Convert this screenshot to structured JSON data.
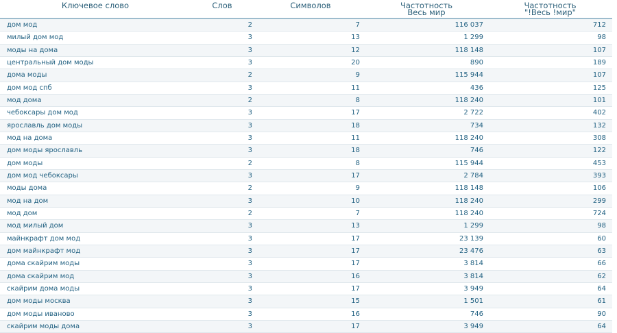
{
  "table": {
    "headers": {
      "keyword": "Ключевое слово",
      "words": "Слов",
      "chars": "Символов",
      "freq_line1": "Частотность",
      "freq_line2": "Весь мир",
      "freq_exact_line1": "Частотность",
      "freq_exact_line2": "\"!Весь !мир\""
    },
    "rows": [
      {
        "keyword": "дом мод",
        "words": "2",
        "chars": "7",
        "freq": "116 037",
        "freq_exact": "712"
      },
      {
        "keyword": "милый дом мод",
        "words": "3",
        "chars": "13",
        "freq": "1 299",
        "freq_exact": "98"
      },
      {
        "keyword": "моды на дома",
        "words": "3",
        "chars": "12",
        "freq": "118 148",
        "freq_exact": "107"
      },
      {
        "keyword": "центральный дом моды",
        "words": "3",
        "chars": "20",
        "freq": "890",
        "freq_exact": "189"
      },
      {
        "keyword": "дома моды",
        "words": "2",
        "chars": "9",
        "freq": "115 944",
        "freq_exact": "107"
      },
      {
        "keyword": "дом мод спб",
        "words": "3",
        "chars": "11",
        "freq": "436",
        "freq_exact": "125"
      },
      {
        "keyword": "мод дома",
        "words": "2",
        "chars": "8",
        "freq": "118 240",
        "freq_exact": "101"
      },
      {
        "keyword": "чебоксары дом мод",
        "words": "3",
        "chars": "17",
        "freq": "2 722",
        "freq_exact": "402"
      },
      {
        "keyword": "ярославль дом моды",
        "words": "3",
        "chars": "18",
        "freq": "734",
        "freq_exact": "132"
      },
      {
        "keyword": "мод на дома",
        "words": "3",
        "chars": "11",
        "freq": "118 240",
        "freq_exact": "308"
      },
      {
        "keyword": "дом моды ярославль",
        "words": "3",
        "chars": "18",
        "freq": "746",
        "freq_exact": "122"
      },
      {
        "keyword": "дом моды",
        "words": "2",
        "chars": "8",
        "freq": "115 944",
        "freq_exact": "453"
      },
      {
        "keyword": "дом мод чебоксары",
        "words": "3",
        "chars": "17",
        "freq": "2 784",
        "freq_exact": "393"
      },
      {
        "keyword": "моды дома",
        "words": "2",
        "chars": "9",
        "freq": "118 148",
        "freq_exact": "106"
      },
      {
        "keyword": "мод на дом",
        "words": "3",
        "chars": "10",
        "freq": "118 240",
        "freq_exact": "299"
      },
      {
        "keyword": "мод дом",
        "words": "2",
        "chars": "7",
        "freq": "118 240",
        "freq_exact": "724"
      },
      {
        "keyword": "мод милый дом",
        "words": "3",
        "chars": "13",
        "freq": "1 299",
        "freq_exact": "98"
      },
      {
        "keyword": "майнкрафт дом мод",
        "words": "3",
        "chars": "17",
        "freq": "23 139",
        "freq_exact": "60"
      },
      {
        "keyword": "дом майнкрафт мод",
        "words": "3",
        "chars": "17",
        "freq": "23 476",
        "freq_exact": "63"
      },
      {
        "keyword": "дома скайрим моды",
        "words": "3",
        "chars": "17",
        "freq": "3 814",
        "freq_exact": "66"
      },
      {
        "keyword": "дома скайрим мод",
        "words": "3",
        "chars": "16",
        "freq": "3 814",
        "freq_exact": "62"
      },
      {
        "keyword": "скайрим дома моды",
        "words": "3",
        "chars": "17",
        "freq": "3 949",
        "freq_exact": "64"
      },
      {
        "keyword": "дом моды москва",
        "words": "3",
        "chars": "15",
        "freq": "1 501",
        "freq_exact": "61"
      },
      {
        "keyword": "дом моды иваново",
        "words": "3",
        "chars": "16",
        "freq": "746",
        "freq_exact": "90"
      },
      {
        "keyword": "скайрим моды дома",
        "words": "3",
        "chars": "17",
        "freq": "3 949",
        "freq_exact": "64"
      }
    ]
  }
}
